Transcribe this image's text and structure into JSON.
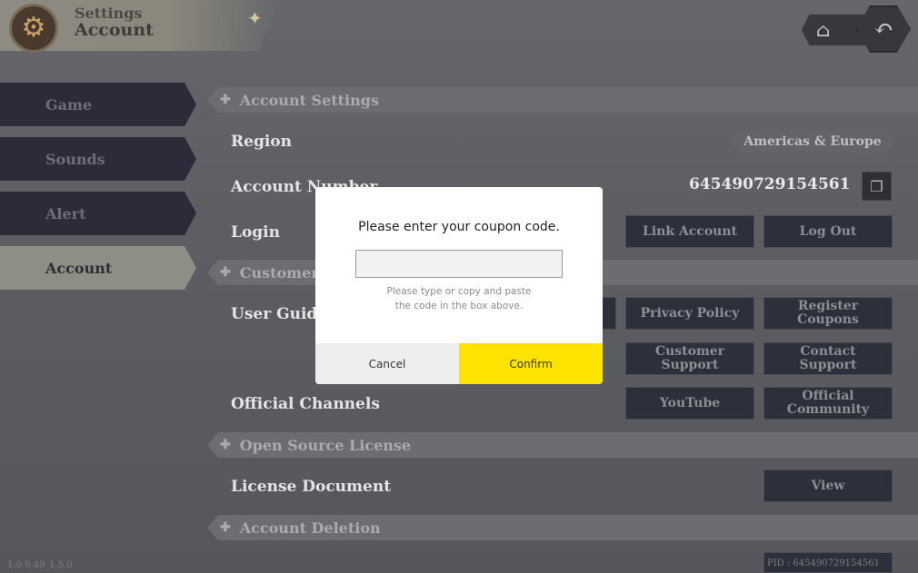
{
  "header": {
    "title_small": "Settings",
    "title_large": "Account",
    "gear_icon": "gear-icon",
    "home_icon": "home-icon",
    "back_icon": "back-arrow-icon"
  },
  "sidebar": {
    "items": [
      {
        "label": "Game",
        "active": false
      },
      {
        "label": "Sounds",
        "active": false
      },
      {
        "label": "Alert",
        "active": false
      },
      {
        "label": "Account",
        "active": true
      }
    ]
  },
  "sections": {
    "account_settings": "Account Settings",
    "customer": "Customer",
    "open_source": "Open Source License",
    "account_deletion": "Account Deletion"
  },
  "rows": {
    "region_label": "Region",
    "region_value": "Americas & Europe",
    "account_number_label": "Account Number",
    "account_number_value": "645490729154561",
    "login_label": "Login",
    "user_guide_label": "User Guide",
    "official_channels_label": "Official Channels",
    "license_document_label": "License Document"
  },
  "buttons": {
    "link_account": "Link Account",
    "log_out": "Log Out",
    "privacy_policy": "Privacy Policy",
    "register_coupons": "Register Coupons",
    "customer_support": "Customer Support",
    "contact_support": "Contact Support",
    "youtube": "YouTube",
    "official_community": "Official Community",
    "view": "View"
  },
  "footer": {
    "version": "1.0.0.49_1.5.0",
    "pid": "PID : 645490729154561"
  },
  "dialog": {
    "message": "Please enter your coupon code.",
    "input_value": "",
    "hint_line1": "Please type or copy and paste",
    "hint_line2": "the code in the box above.",
    "cancel_label": "Cancel",
    "confirm_label": "Confirm",
    "confirm_color": "#fde400"
  }
}
